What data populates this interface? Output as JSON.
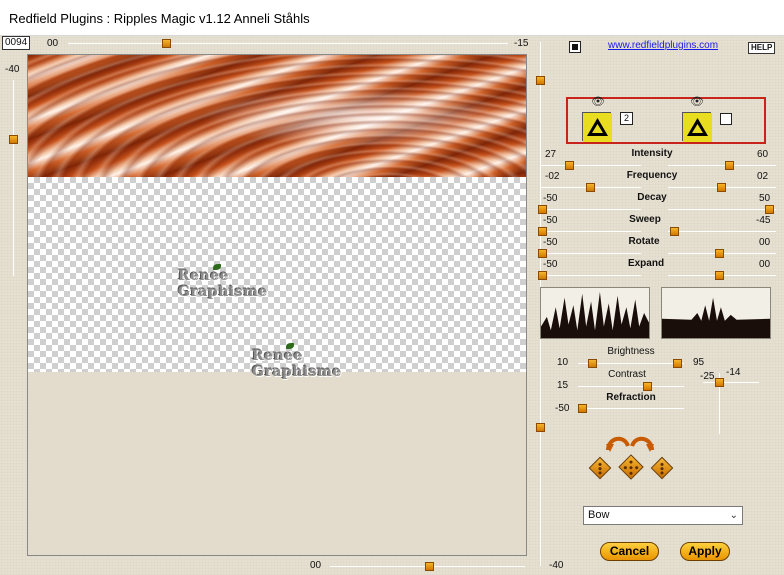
{
  "window": {
    "title": "Redfield Plugins : Ripples Magic v1.12   Anneli Ståhls"
  },
  "top": {
    "frame_value": "0094",
    "hslider_left": "00",
    "hslider_right": "-15",
    "vslider_top": "-40"
  },
  "bottom": {
    "hslider_value": "00",
    "vslider_value": "-40"
  },
  "preview": {
    "watermark_line1": "Renee",
    "watermark_line2": "Graphisme"
  },
  "header": {
    "link": "www.redfieldplugins.com",
    "help": "HELP"
  },
  "layers": {
    "layer1_badge": "2"
  },
  "params": [
    {
      "label": "Intensity",
      "left": "27",
      "right": "60"
    },
    {
      "label": "Frequency",
      "left": "-02",
      "right": "02"
    },
    {
      "label": "Decay",
      "left": "-50",
      "right": "50"
    },
    {
      "label": "Sweep",
      "left": "-50",
      "right": "-45"
    },
    {
      "label": "Rotate",
      "left": "-50",
      "right": "00"
    },
    {
      "label": "Expand",
      "left": "-50",
      "right": "00"
    }
  ],
  "tone": {
    "brightness_label": "Brightness",
    "brightness_left": "10",
    "brightness_right": "95",
    "contrast_label": "Contrast",
    "contrast_value": "15",
    "refraction_label": "Refraction",
    "refraction_value": "-50",
    "vslider_top": "-25",
    "vslider_right": "-14"
  },
  "style_select": {
    "value": "Bow"
  },
  "buttons": {
    "cancel": "Cancel",
    "apply": "Apply"
  },
  "colors": {
    "accent": "#f0a500",
    "frame_red": "#c8241b",
    "background": "#e6e0d1"
  }
}
